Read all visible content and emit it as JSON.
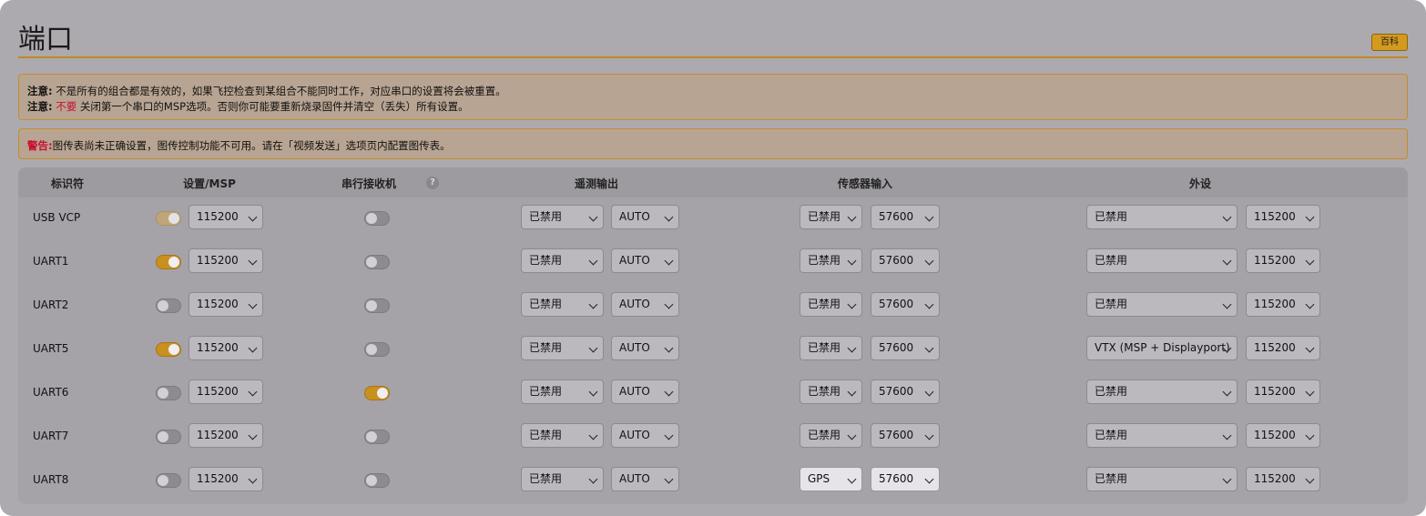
{
  "page": {
    "title": "端口",
    "wiki_label": "百科"
  },
  "notes": {
    "line1_label": "注意:",
    "line1_text": "不是所有的组合都是有效的，如果飞控检查到某组合不能同时工作，对应串口的设置将会被重置。",
    "line2_label": "注意:",
    "line2_emph": "不要",
    "line2_text": "关闭第一个串口的MSP选项。否则你可能要重新烧录固件并清空（丢失）所有设置。",
    "warning_label": "警告:",
    "warning_text": "图传表尚未正确设置，图传控制功能不可用。请在「视频发送」选项页内配置图传表。"
  },
  "colors": {
    "accent": "#C8901E",
    "alert": "#C8102E",
    "highlight_ring": "#D01A1A"
  },
  "table": {
    "headers": {
      "identifier": "标识符",
      "config_msp": "设置/MSP",
      "serial_rx": "串行接收机",
      "help_icon": "?",
      "telemetry": "遥测输出",
      "sensor": "传感器输入",
      "peripherals": "外设"
    },
    "rows": [
      {
        "id": "USB VCP",
        "msp": "dim",
        "msp_baud": "115200",
        "rx": false,
        "telemetry": "已禁用",
        "telemetry_baud": "AUTO",
        "sensor": "已禁用",
        "sensor_baud": "57600",
        "peripheral": "已禁用",
        "peripheral_baud": "115200"
      },
      {
        "id": "UART1",
        "msp": "on",
        "msp_baud": "115200",
        "rx": false,
        "telemetry": "已禁用",
        "telemetry_baud": "AUTO",
        "sensor": "已禁用",
        "sensor_baud": "57600",
        "peripheral": "已禁用",
        "peripheral_baud": "115200"
      },
      {
        "id": "UART2",
        "msp": "off",
        "msp_baud": "115200",
        "rx": false,
        "telemetry": "已禁用",
        "telemetry_baud": "AUTO",
        "sensor": "已禁用",
        "sensor_baud": "57600",
        "peripheral": "已禁用",
        "peripheral_baud": "115200"
      },
      {
        "id": "UART5",
        "msp": "on",
        "msp_baud": "115200",
        "rx": false,
        "telemetry": "已禁用",
        "telemetry_baud": "AUTO",
        "sensor": "已禁用",
        "sensor_baud": "57600",
        "peripheral": "VTX (MSP + Displayport)",
        "peripheral_baud": "115200"
      },
      {
        "id": "UART6",
        "msp": "off",
        "msp_baud": "115200",
        "rx": true,
        "telemetry": "已禁用",
        "telemetry_baud": "AUTO",
        "sensor": "已禁用",
        "sensor_baud": "57600",
        "peripheral": "已禁用",
        "peripheral_baud": "115200"
      },
      {
        "id": "UART7",
        "msp": "off",
        "msp_baud": "115200",
        "rx": false,
        "telemetry": "已禁用",
        "telemetry_baud": "AUTO",
        "sensor": "已禁用",
        "sensor_baud": "57600",
        "peripheral": "已禁用",
        "peripheral_baud": "115200"
      },
      {
        "id": "UART8",
        "msp": "off",
        "msp_baud": "115200",
        "rx": false,
        "telemetry": "已禁用",
        "telemetry_baud": "AUTO",
        "sensor": "GPS",
        "sensor_baud": "57600",
        "peripheral": "已禁用",
        "peripheral_baud": "115200",
        "highlighted": true
      }
    ]
  }
}
